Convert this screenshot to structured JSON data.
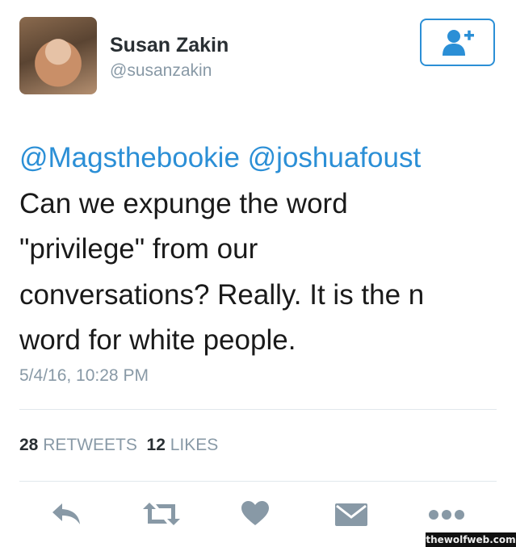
{
  "user": {
    "name": "Susan Zakin",
    "handle": "@susanzakin"
  },
  "tweet": {
    "mention_1": "@Magsthebookie",
    "mention_2": "@joshuafoust",
    "body": "Can we expunge the word\n\"privilege\" from our\nconversations? Really. It is the n\nword for white people.",
    "timestamp": "5/4/16, 10:28 PM"
  },
  "stats": {
    "retweets_count": "28",
    "retweets_label": "RETWEETS",
    "likes_count": "12",
    "likes_label": "LIKES"
  },
  "icons": {
    "follow": "follow-user-icon",
    "reply": "reply-icon",
    "retweet": "retweet-icon",
    "like": "heart-icon",
    "dm": "envelope-icon",
    "more": "more-icon"
  },
  "colors": {
    "accent": "#2b8fd6",
    "icon_gray": "#8899a6",
    "text": "#1a1a1a"
  },
  "watermark": "thewolfweb.com"
}
